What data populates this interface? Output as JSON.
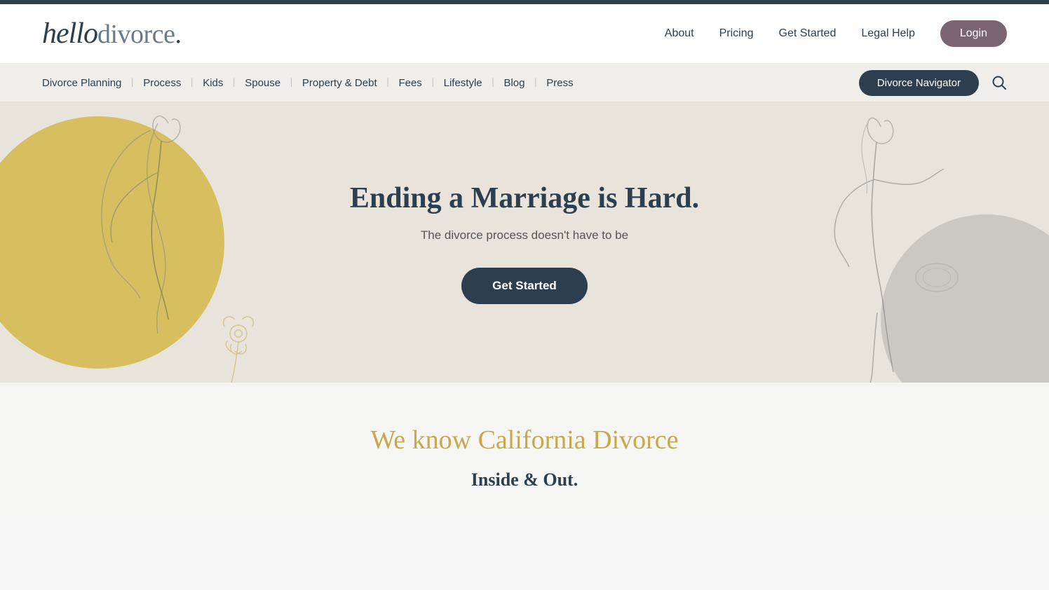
{
  "topbar": {},
  "nav": {
    "logo_hello": "hello",
    "logo_divorce": "divorce",
    "logo_dot": ".",
    "links": [
      {
        "label": "About",
        "id": "about"
      },
      {
        "label": "Pricing",
        "id": "pricing"
      },
      {
        "label": "Get Started",
        "id": "get-started"
      },
      {
        "label": "Legal Help",
        "id": "legal-help"
      }
    ],
    "login_label": "Login"
  },
  "secondary_nav": {
    "links": [
      {
        "label": "Divorce Planning",
        "id": "divorce-planning"
      },
      {
        "label": "Process",
        "id": "process"
      },
      {
        "label": "Kids",
        "id": "kids"
      },
      {
        "label": "Spouse",
        "id": "spouse"
      },
      {
        "label": "Property & Debt",
        "id": "property-debt"
      },
      {
        "label": "Fees",
        "id": "fees"
      },
      {
        "label": "Lifestyle",
        "id": "lifestyle"
      },
      {
        "label": "Blog",
        "id": "blog"
      },
      {
        "label": "Press",
        "id": "press"
      }
    ],
    "navigator_btn": "Divorce Navigator",
    "search_icon": "🔍"
  },
  "hero": {
    "title": "Ending a Marriage is Hard.",
    "subtitle": "The divorce process doesn't have to be",
    "cta_label": "Get Started"
  },
  "bottom": {
    "title": "We know California Divorce",
    "subtitle": "Inside & Out."
  }
}
